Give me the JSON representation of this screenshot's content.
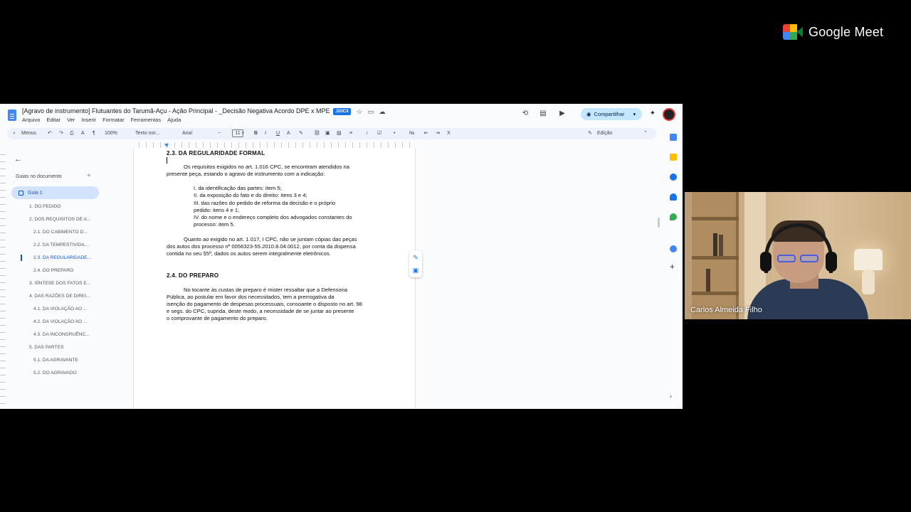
{
  "meet": {
    "brand": "Google Meet"
  },
  "docs": {
    "title": "[Agravo de instrumento] Flutuantes do Tarumã-Açu - Ação Principal - _Decisão Negativa Acordo DPE x MPE",
    "badge": ".DOCX",
    "menu": [
      "Arquivo",
      "Editar",
      "Ver",
      "Inserir",
      "Formatar",
      "Ferramentas",
      "Ajuda"
    ],
    "share_label": "Compartilhar",
    "toolbar": {
      "menus": "Menus",
      "zoom": "100%",
      "style": "Texto nor...",
      "font": "Arial",
      "font_size": "11",
      "mode": "Edição"
    },
    "outline": {
      "heading": "Guias no documento",
      "guide": "Guia 1",
      "items": [
        "1. DO PEDIDO",
        "2. DOS REQUISITOS DE A...",
        "2.1. DO CABIMENTO D...",
        "2.2. DA TEMPESTIVIDA...",
        "2.3. DA REGULARIDADE...",
        "2.4. DO PREPARO",
        "3. SÍNTESE DOS FATOS E...",
        "4. DAS RAZÕES DE DIREI...",
        "4.1. DA VIOLAÇÃO AO ...",
        "4.2. DA VIOLAÇÃO AO ...",
        "4.3. DA INCONGRUÊNC...",
        "5. DAS PARTES",
        "5.1. DA AGRAVANTE",
        "5.2. DO AGRAVADO"
      ]
    },
    "page": {
      "heading1": "2.3. DA REGULARIDADE FORMAL",
      "p1_l1": "Os requisitos exigidos no art. 1.016 CPC, se encontram atendidos na",
      "p1_l2": "presente peça, estando o agravo de instrumento com a indicação:",
      "list1": "I. da identificação das partes: item 5;",
      "list2": "II. da exposição do fato e do direito: itens 3 e 4;",
      "list3a": "III. das razões do pedido de reforma da decisão e o próprio",
      "list3b": "pedido: itens 4 e 1;",
      "list4a": "IV. do nome e o endereço completo dos advogados constantes do",
      "list4b": "processo: item 5.",
      "p2_l1": "Quanto ao exigido no art. 1.017, I CPC, não se juntam cópias das peças",
      "p2_l2": "dos autos dos processo nº 0056323-55.2010.8.04.0012, por conta da dispensa",
      "p2_l3": "contida no seu §5º, dados os autos serem integralmente eletrônicos.",
      "heading2": "2.4. DO PREPARO",
      "p3_l1": "No tocante às custas de preparo é mister ressaltar que a Defensoria",
      "p3_l2": "Pública, ao postular em favor dos necessitados, tem a prerrogativa da",
      "p3_l3": "isenção do pagamento de despesas processuais, consoante o disposto no art. 98",
      "p3_l4": "e segs. do CPC, suprida, deste modo, a necessidade de se juntar ao presente",
      "p3_l5": "o comprovante de pagamento do preparo."
    }
  },
  "participant": {
    "name": "Carlos Almeida Filho"
  },
  "colors": {
    "accent": "#0b57d0",
    "share_bg": "#c2e7ff",
    "toolbar_bg": "#edf2fa"
  }
}
